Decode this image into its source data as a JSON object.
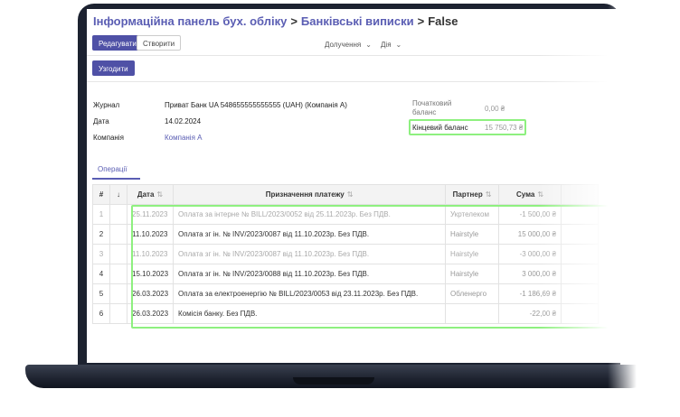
{
  "breadcrumb": {
    "items": [
      "Інформаційна панель бух. обліку",
      "Банківські виписки"
    ],
    "current": "False",
    "separator": ">"
  },
  "toolbar": {
    "edit_label": "Редагувати",
    "create_label": "Створити",
    "attachments_label": "Долучення",
    "actions_label": "Дія",
    "reconcile_label": "Узгодити"
  },
  "form": {
    "journal_label": "Журнал",
    "journal_value": "Приват Банк UA 548655555555555 (UAH) (Компанія А)",
    "date_label": "Дата",
    "date_value": "14.02.2024",
    "company_label": "Компанія",
    "company_value": "Компанія А",
    "start_balance_label_1": "Початковий",
    "start_balance_label_2": "баланс",
    "start_balance_value": "0,00 ₴",
    "end_balance_label": "Кінцевий баланс",
    "end_balance_value": "15 750,73 ₴"
  },
  "tabs": {
    "operations_label": "Операції"
  },
  "table": {
    "headers": {
      "num": "#",
      "arrow": "↓",
      "date": "Дата",
      "purpose": "Призначення платежу",
      "partner": "Партнер",
      "amount": "Сума"
    },
    "rows": [
      {
        "n": "1",
        "date": "25.11.2023",
        "purpose": "Оплата за інтерне № BILL/2023/0052 від 25.11.2023р. Без ПДВ.",
        "partner": "Укртелеком",
        "amount": "-1 500,00 ₴"
      },
      {
        "n": "2",
        "date": "11.10.2023",
        "purpose": "Оплата зг ін. № INV/2023/0087 від 11.10.2023р. Без ПДВ.",
        "partner": "Hairstyle",
        "amount": "15 000,00 ₴"
      },
      {
        "n": "3",
        "date": "11.10.2023",
        "purpose": "Оплата зг ін. № INV/2023/0087 від 11.10.2023р. Без ПДВ.",
        "partner": "Hairstyle",
        "amount": "-3 000,00 ₴"
      },
      {
        "n": "4",
        "date": "15.10.2023",
        "purpose": "Оплата зг ін. № INV/2023/0088 від 11.10.2023р. Без ПДВ.",
        "partner": "Hairstyle",
        "amount": "3 000,00 ₴"
      },
      {
        "n": "5",
        "date": "26.03.2023",
        "purpose": "Оплата за електроенергію № BILL/2023/0053 від 23.11.2023р. Без ПДВ.",
        "partner": "Обленерго",
        "amount": "-1 186,69 ₴"
      },
      {
        "n": "6",
        "date": "26.03.2023",
        "purpose": "Комісія банку. Без ПДВ.",
        "partner": "",
        "amount": "-22,00 ₴"
      }
    ]
  },
  "colors": {
    "brand": "#5a5db3",
    "primary_button": "#4f51a6",
    "highlight": "#8ef07f",
    "laptop_frame": "#1c2230"
  }
}
